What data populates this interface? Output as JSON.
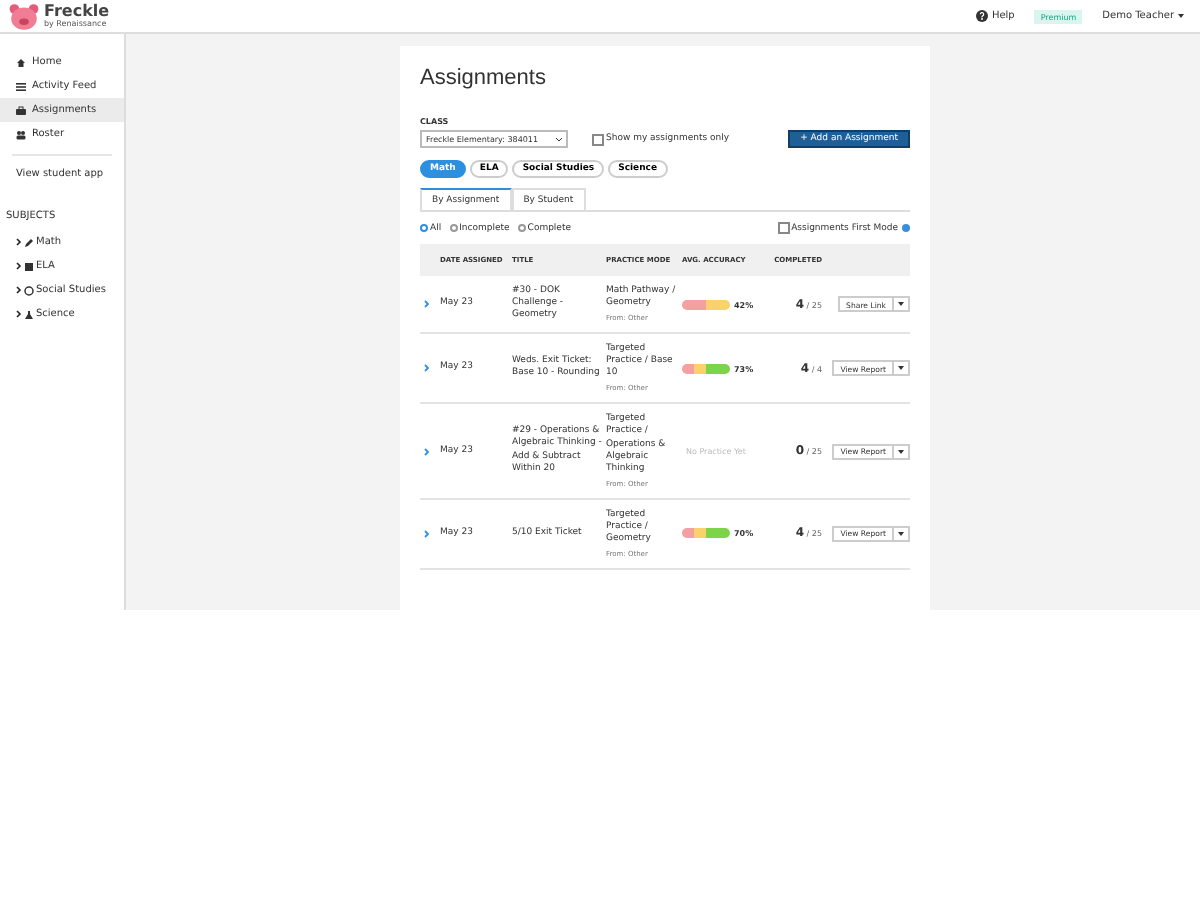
{
  "header": {
    "brand": "Freckle",
    "brand_sub": "by Renaissance",
    "help": "Help",
    "badge": "Premium",
    "user": "Demo Teacher"
  },
  "sidebar": {
    "items": [
      {
        "label": "Home",
        "selected": false
      },
      {
        "label": "Activity Feed",
        "selected": false
      },
      {
        "label": "Assignments",
        "selected": true
      },
      {
        "label": "Roster",
        "selected": false
      }
    ],
    "student_app": "View student app",
    "subjects_heading": "SUBJECTS",
    "subjects": [
      {
        "label": "Math"
      },
      {
        "label": "ELA"
      },
      {
        "label": "Social Studies"
      },
      {
        "label": "Science"
      }
    ]
  },
  "page": {
    "title": "Assignments",
    "class_label": "CLASS",
    "class_value": "Freckle Elementary: 384011",
    "show_mine": {
      "label": "Show my assignments only",
      "checked": false
    },
    "add_button": "+ Add an Assignment",
    "subject_pills": [
      {
        "label": "Math",
        "selected": true
      },
      {
        "label": "ELA",
        "selected": false
      },
      {
        "label": "Social Studies",
        "selected": false
      },
      {
        "label": "Science",
        "selected": false
      }
    ],
    "tabs": [
      {
        "label": "By Assignment",
        "selected": true
      },
      {
        "label": "By Student",
        "selected": false
      }
    ],
    "filters": [
      {
        "label": "All",
        "selected": true
      },
      {
        "label": "Incomplete",
        "selected": false
      },
      {
        "label": "Complete",
        "selected": false
      }
    ],
    "first_mode": {
      "label": "Assignments First Mode",
      "checked": false
    },
    "table": {
      "columns": [
        "DATE ASSIGNED",
        "TITLE",
        "PRACTICE MODE",
        "AVG. ACCURACY",
        "COMPLETED"
      ],
      "rows": [
        {
          "date": "May 23",
          "title": "#30 - DOK Challenge - Geometry",
          "mode": "Math Pathway / Geometry",
          "from": "From: Other",
          "accuracy": "42%",
          "segments": [
            {
              "color": "#f4a0a0"
            },
            {
              "color": "#f8d26a"
            }
          ],
          "done": "4",
          "total": "/ 25",
          "action": "Share Link"
        },
        {
          "date": "May 23",
          "title": "Weds. Exit Ticket: Base 10 - Rounding",
          "mode": "Targeted Practice / Base 10",
          "from": "From: Other",
          "accuracy": "73%",
          "segments": [
            {
              "color": "#f4a0a0"
            },
            {
              "color": "#f8d26a"
            },
            {
              "color": "#7dd34a"
            },
            {
              "color": "#7dd34a"
            }
          ],
          "done": "4",
          "total": "/ 4",
          "action": "View Report"
        },
        {
          "date": "May 23",
          "title": "#29 - Operations & Algebraic Thinking - Add & Subtract Within 20",
          "mode": "Targeted Practice / Operations & Algebraic Thinking",
          "from": "From: Other",
          "no_practice": "No Practice Yet",
          "done": "0",
          "total": "/ 25",
          "action": "View Report"
        },
        {
          "date": "May 23",
          "title": "5/10 Exit Ticket",
          "mode": "Targeted Practice / Geometry",
          "from": "From: Other",
          "accuracy": "70%",
          "segments": [
            {
              "color": "#f4a0a0"
            },
            {
              "color": "#f8d26a"
            },
            {
              "color": "#7dd34a"
            },
            {
              "color": "#7dd34a"
            }
          ],
          "done": "4",
          "total": "/ 25",
          "action": "View Report"
        }
      ]
    }
  }
}
